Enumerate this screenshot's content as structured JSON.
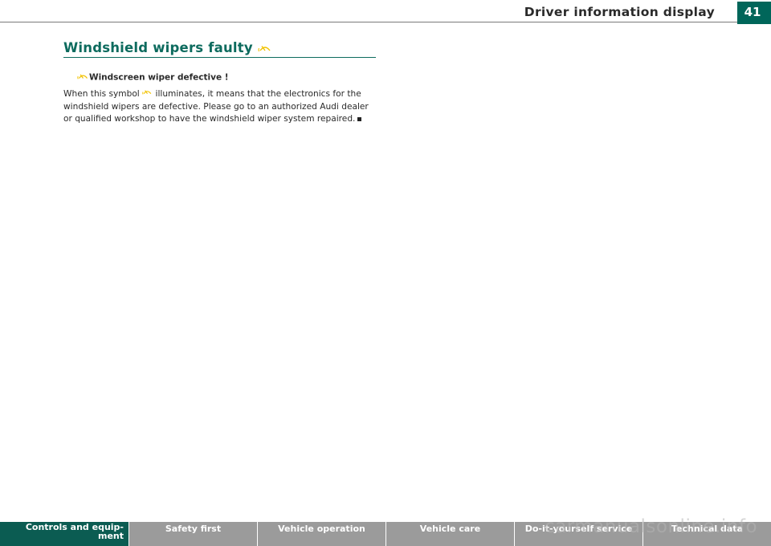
{
  "header": {
    "running_title": "Driver information display",
    "page_number": "41"
  },
  "section": {
    "title": "Windshield wipers faulty",
    "icon": "windshield-wiper-warning-icon",
    "icon_color": "#f2c200",
    "subheading": "Windscreen wiper defective !",
    "body_before_icon": "When this symbol",
    "body_after_icon": "illuminates, it means that the electronics for the windshield wipers are defective. Please go to an authorized Audi dealer or qualified workshop to have the windshield wiper system repaired."
  },
  "footer": {
    "tabs": [
      {
        "label": "Controls and equip-\nment",
        "active": true
      },
      {
        "label": "Safety first",
        "active": false
      },
      {
        "label": "Vehicle operation",
        "active": false
      },
      {
        "label": "Vehicle care",
        "active": false
      },
      {
        "label": "Do-it-yourself service",
        "active": false
      },
      {
        "label": "Technical data",
        "active": false
      }
    ]
  },
  "watermark": "carmanualsonline.info",
  "colors": {
    "accent": "#0d6b5e",
    "footer_active": "#0b5c52",
    "footer_inactive": "#9b9b9b",
    "page_tab": "#00665a"
  }
}
